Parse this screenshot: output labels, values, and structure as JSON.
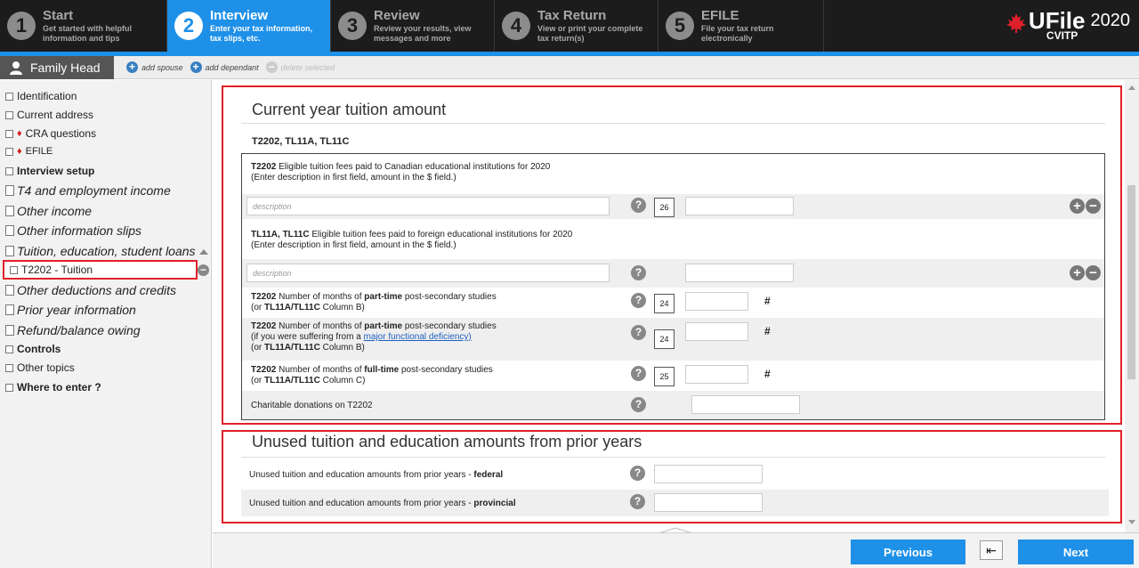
{
  "steps": [
    {
      "num": "1",
      "title": "Start",
      "sub1": "Get started with helpful",
      "sub2": "information and tips"
    },
    {
      "num": "2",
      "title": "Interview",
      "sub1": "Enter your tax information,",
      "sub2": "tax slips, etc."
    },
    {
      "num": "3",
      "title": "Review",
      "sub1": "Review your results, view",
      "sub2": "messages and more"
    },
    {
      "num": "4",
      "title": "Tax Return",
      "sub1": "View or print your complete",
      "sub2": "tax return(s)"
    },
    {
      "num": "5",
      "title": "EFILE",
      "sub1": "File your tax return",
      "sub2": "electronically"
    }
  ],
  "logo": {
    "brand": "UFile",
    "sub": "CVITP",
    "year": "2020"
  },
  "colors": {
    "accent": "#1e90e8",
    "highlight": "#e0202a",
    "topbar": "#1c1c1c"
  },
  "subbar": {
    "family_head": "Family Head",
    "add_spouse": "add spouse",
    "add_dependant": "add dependant",
    "delete_selected": "delete selected"
  },
  "sidebar": {
    "identification": "Identification",
    "current_address": "Current address",
    "cra_questions": "CRA questions",
    "efile": "EFILE",
    "interview_setup": "Interview setup",
    "t4": "T4 and employment income",
    "other_income": "Other income",
    "other_slips": "Other information slips",
    "tuition": "Tuition, education, student loans",
    "t2202": "T2202 - Tuition",
    "other_deductions": "Other deductions and credits",
    "prior_year": "Prior year information",
    "refund": "Refund/balance owing",
    "controls": "Controls",
    "other_topics": "Other topics",
    "where_to_enter": "Where to enter ?"
  },
  "section1": {
    "title": "Current year tuition amount",
    "forms": "T2202, TL11A, TL11C",
    "row1": {
      "bold": "T2202",
      "text": "Eligible tuition fees paid to Canadian educational institutions for 2020",
      "text2": "(Enter description in first field, amount in the $ field.)",
      "placeholder": "description",
      "line": "26"
    },
    "row2": {
      "bold": "TL11A, TL11C",
      "text": "Eligible tuition fees paid to foreign educational institutions for 2020",
      "text2": "(Enter description in first field, amount in the $ field.)",
      "placeholder": "description"
    },
    "row3": {
      "a": "T2202",
      "b": "Number of months of",
      "c": "part-time",
      "d": "post-secondary studies",
      "e": "(or",
      "f": "TL11A/TL11C",
      "g": "Column B)",
      "line": "24",
      "hash": "#"
    },
    "row4": {
      "a": "T2202",
      "b": "Number of months of",
      "c": "part-time",
      "d": "post-secondary studies",
      "e": "(if you were suffering from a",
      "link": "major functional deficiency)",
      "f": "(or",
      "g": "TL11A/TL11C",
      "h": "Column B)",
      "line": "24",
      "hash": "#"
    },
    "row5": {
      "a": "T2202",
      "b": "Number of months of",
      "c": "full-time",
      "d": "post-secondary studies",
      "e": "(or",
      "f": "TL11A/TL11C",
      "g": "Column C)",
      "line": "25",
      "hash": "#"
    },
    "row6": {
      "text": "Charitable donations on T2202"
    }
  },
  "section2": {
    "title": "Unused tuition and education amounts from prior years",
    "federal_text": "Unused tuition and education amounts from prior years -",
    "federal_bold": "federal",
    "prov_text": "Unused tuition and education amounts from prior years -",
    "prov_bold": "provincial"
  },
  "footer": {
    "previous": "Previous",
    "next": "Next"
  }
}
